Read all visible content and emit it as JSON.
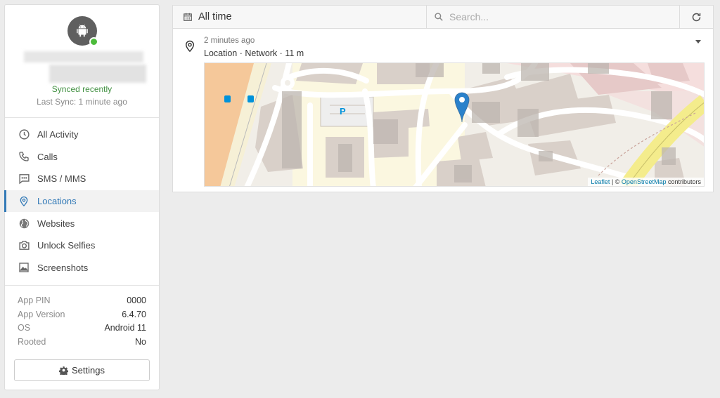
{
  "profile": {
    "synced_status": "Synced recently",
    "last_sync": "Last Sync: 1 minute ago",
    "status_color": "#4cbb3a"
  },
  "nav": {
    "items": [
      {
        "label": "All Activity",
        "icon": "clock-icon"
      },
      {
        "label": "Calls",
        "icon": "phone-icon"
      },
      {
        "label": "SMS / MMS",
        "icon": "message-icon"
      },
      {
        "label": "Locations",
        "icon": "map-pin-icon",
        "active": true
      },
      {
        "label": "Websites",
        "icon": "globe-icon"
      },
      {
        "label": "Unlock Selfies",
        "icon": "camera-icon"
      },
      {
        "label": "Screenshots",
        "icon": "image-icon"
      }
    ]
  },
  "info": {
    "rows": [
      {
        "key": "App PIN",
        "value": "0000"
      },
      {
        "key": "App Version",
        "value": "6.4.70"
      },
      {
        "key": "OS",
        "value": "Android 11"
      },
      {
        "key": "Rooted",
        "value": "No"
      }
    ]
  },
  "settings_label": "Settings",
  "toolbar": {
    "date_range": "All time",
    "search_placeholder": "Search..."
  },
  "entry": {
    "time": "2 minutes ago",
    "meta": "Location · Network · 11 m"
  },
  "map": {
    "attrib_leaflet": "Leaflet",
    "attrib_sep": " | © ",
    "attrib_osm": "OpenStreetMap",
    "attrib_suffix": " contributors",
    "parking_label": "P"
  },
  "colors": {
    "accent": "#337ab7",
    "marker": "#2a81cb"
  }
}
